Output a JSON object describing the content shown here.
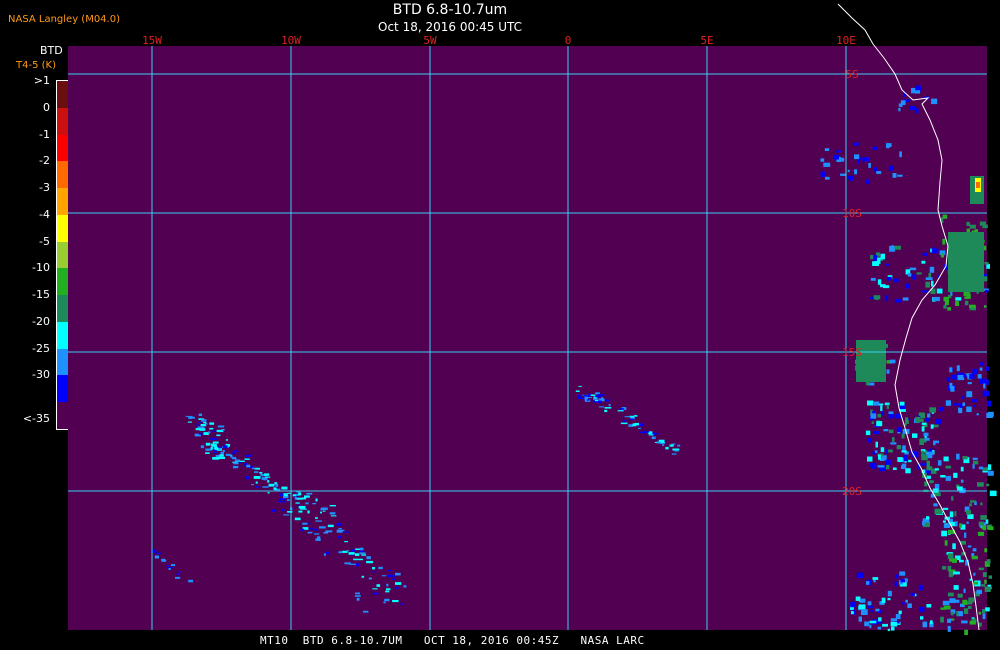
{
  "header": {
    "org": "NASA Langley (M04.0)",
    "title": "BTD 6.8-10.7um",
    "date": "Oct 18, 2016 00:45 UTC"
  },
  "footer": {
    "text": "MT10  BTD 6.8-10.7UM   OCT 18, 2016 00:45Z   NASA LARC"
  },
  "legend": {
    "title": "BTD",
    "unit": "T4-5 (K)",
    "entries": [
      {
        "label": ">1",
        "color": "#6a0f0f"
      },
      {
        "label": "0",
        "color": "#cc1010"
      },
      {
        "label": "-1",
        "color": "#ff0000"
      },
      {
        "label": "-2",
        "color": "#ff6a00"
      },
      {
        "label": "-3",
        "color": "#ffa500"
      },
      {
        "label": "-4",
        "color": "#ffff00"
      },
      {
        "label": "-5",
        "color": "#9acd32"
      },
      {
        "label": "-10",
        "color": "#22b022"
      },
      {
        "label": "-15",
        "color": "#1e8a5a"
      },
      {
        "label": "-20",
        "color": "#00ffff"
      },
      {
        "label": "-25",
        "color": "#1e90ff"
      },
      {
        "label": "-30",
        "color": "#0000ff"
      },
      {
        "label": "<-35",
        "color": "#520052"
      }
    ]
  },
  "map": {
    "background_color": "#520052",
    "grid_color": "#3ad0f0",
    "coast_color": "#ffffff",
    "label_color": "#e02020",
    "lon_labels": [
      "15W",
      "10W",
      "5W",
      "0",
      "5E",
      "10E"
    ],
    "lat_labels": [
      "5S",
      "10S",
      "15S",
      "20S"
    ]
  }
}
